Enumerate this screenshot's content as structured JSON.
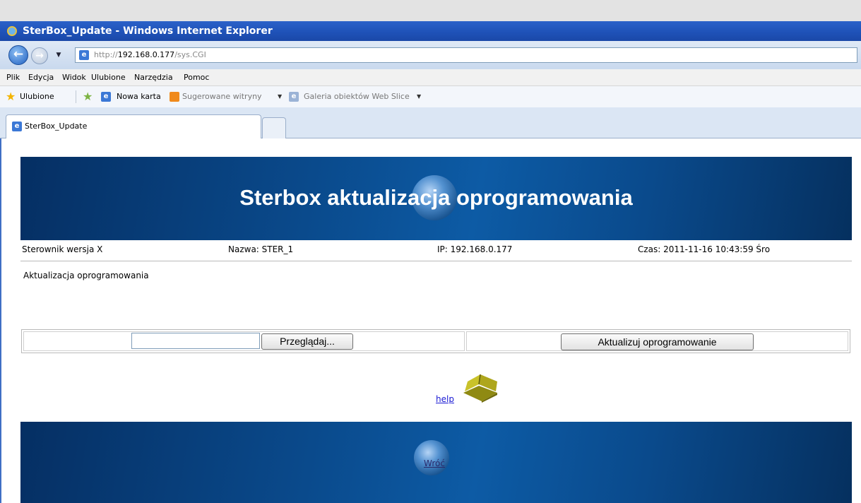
{
  "window": {
    "title": "SterBox_Update - Windows Internet Explorer"
  },
  "nav": {
    "back_label": "←",
    "forward_label": "→",
    "dropdown_label": "▼",
    "address_prefix": "http://",
    "address_host": "192.168.0.177",
    "address_path": "/sys.CGI"
  },
  "menu": {
    "items": [
      "Plik",
      "Edycja",
      "Widok",
      "Ulubione",
      "Narzędzia",
      "Pomoc"
    ]
  },
  "favorites": {
    "favorites_label": "Ulubione",
    "new_tab_label": "Nowa karta",
    "suggested_label": "Sugerowane witryny",
    "webslice_label": "Galeria obiektów Web Slice"
  },
  "tabs": {
    "active_label": "SterBox_Update"
  },
  "page": {
    "banner_title": "Sterbox aktualizacja oprogramowania",
    "info": {
      "controller": "Sterownik wersja X",
      "name": "Nazwa: STER_1",
      "ip": "IP: 192.168.0.177",
      "time": "Czas: 2011-11-16 10:43:59 Śro"
    },
    "section_label": "Aktualizacja oprogramowania",
    "file_input_value": "",
    "browse_label": "Przeglądaj...",
    "update_label": "Aktualizuj oprogramowanie",
    "help_label": "help",
    "back_link_label": "Wróć"
  },
  "colors": {
    "titlebar": "#2b62c9",
    "banner_dark": "#052f63",
    "banner_light": "#0d5ba5",
    "link": "#1a1ad4"
  }
}
